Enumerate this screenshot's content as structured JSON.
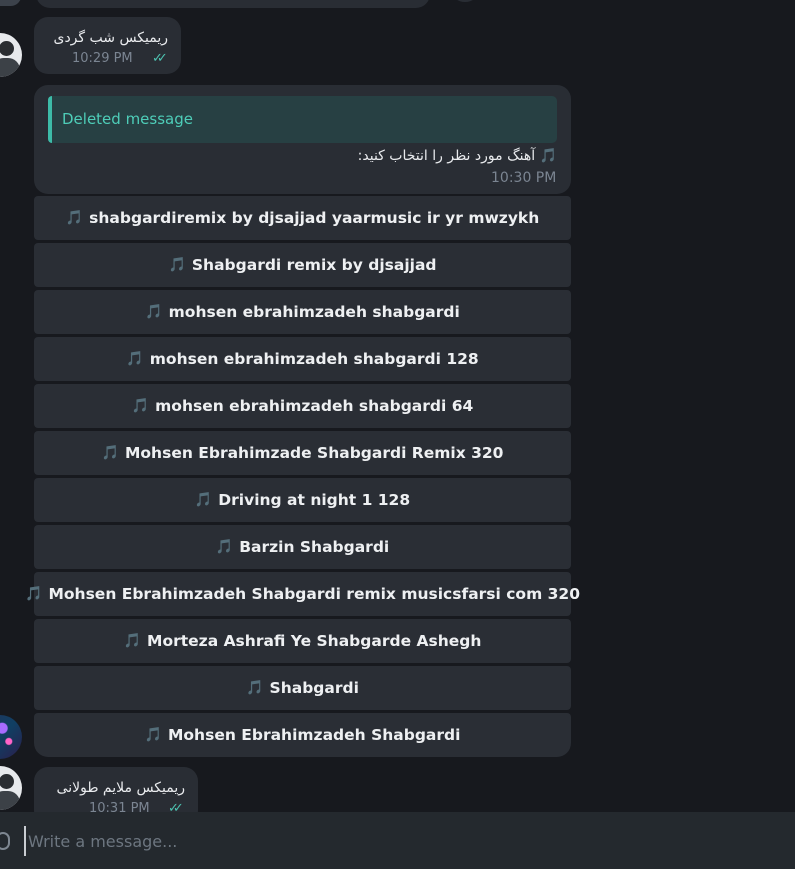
{
  "messages": {
    "first": {
      "text": "ریمیکس شب گردی",
      "time": "10:29 PM"
    },
    "bot": {
      "reply_label": "Deleted message",
      "prompt": "🎵 آهنگ مورد نظر را انتخاب کنید:",
      "time": "10:30 PM"
    },
    "last": {
      "text": "ریمیکس ملایم طولانی",
      "time": "10:31 PM"
    }
  },
  "keyboard": [
    "shabgardiremix by djsajjad yaarmusic ir yr mwzykh",
    "Shabgardi remix by djsajjad",
    "mohsen ebrahimzadeh shabgardi",
    "mohsen ebrahimzadeh shabgardi 128",
    "mohsen ebrahimzadeh shabgardi 64",
    "Mohsen Ebrahimzade Shabgardi Remix 320",
    "Driving at night 1 128",
    "Barzin Shabgardi",
    "Mohsen Ebrahimzadeh Shabgardi remix musicsfarsi com 320",
    "Morteza Ashrafi Ye Shabgarde Ashegh",
    "Shabgardi",
    "Mohsen Ebrahimzadeh Shabgardi"
  ],
  "composer": {
    "placeholder": "Write a message..."
  },
  "icons": {
    "music": "music-note-icon",
    "read": "double-check-icon",
    "attach": "paperclip-icon"
  },
  "colors": {
    "accent": "#4cc2b0",
    "bubble": "#292d34",
    "background": "#17191e"
  }
}
